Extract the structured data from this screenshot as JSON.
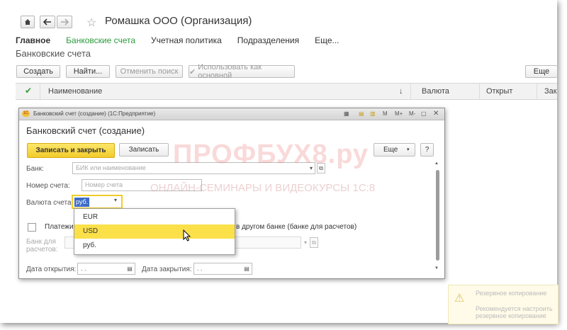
{
  "window": {
    "title": "Ромашка ООО (Организация)"
  },
  "nav": {
    "home_icon": "home-icon",
    "back_icon": "arrow-left-icon",
    "forward_icon": "arrow-right-icon",
    "star_icon": "star-icon"
  },
  "tabs": [
    {
      "label": "Главное"
    },
    {
      "label": "Банковские счета"
    },
    {
      "label": "Учетная политика"
    },
    {
      "label": "Подразделения"
    },
    {
      "label": "Еще..."
    }
  ],
  "section": {
    "title": "Банковские счета"
  },
  "toolbar": {
    "create": "Создать",
    "find": "Найти...",
    "cancel_search": "Отменить поиск",
    "use_main": "Использовать как основной",
    "more": "Еще"
  },
  "grid": {
    "headers": {
      "name": "Наименование",
      "sort": "↓",
      "currency": "Валюта",
      "opened": "Открыт",
      "closed": "Зак"
    }
  },
  "dialog": {
    "titlebar": "Банковский счет (создание)  (1С:Предприятие)",
    "titlebar_buttons": {
      "m": "M",
      "mplus": "M+",
      "mminus": "M-"
    },
    "heading": "Банковский счет (создание)",
    "save_close": "Записать и закрыть",
    "save": "Записать",
    "more": "Еще",
    "help": "?",
    "bank_label": "Банк:",
    "bank_placeholder": "БИК или наименование",
    "account_label": "Номер счета:",
    "account_placeholder": "Номер счета",
    "currency_label": "Валюта счета:",
    "currency_value": "руб.",
    "payments_label": "Платежи п",
    "payments_tail": "в другом банке (банке для расчетов)",
    "settle_bank_label_1": "Банк для",
    "settle_bank_label_2": "расчетов:",
    "open_date_label": "Дата открытия:",
    "open_date_value": " .  .",
    "close_date_label": "Дата закрытия:",
    "close_date_value": " .  .",
    "dropdown_items": [
      "EUR",
      "USD",
      "руб."
    ],
    "highlight_color": "#fbe04a",
    "accent_color": "#f5d33b"
  },
  "watermark": {
    "line1": "ПРОФБУХ8.ру",
    "line2": "ОНЛАЙН-СЕМИНАРЫ И ВИДЕОКУРСЫ 1С:8"
  },
  "notification": {
    "title": "Резервное копирование",
    "text": "Рекомендуется настроить резервное копирование"
  },
  "colors": {
    "green_tab": "#2c9a3e",
    "link_green": "#4a9d4a"
  }
}
